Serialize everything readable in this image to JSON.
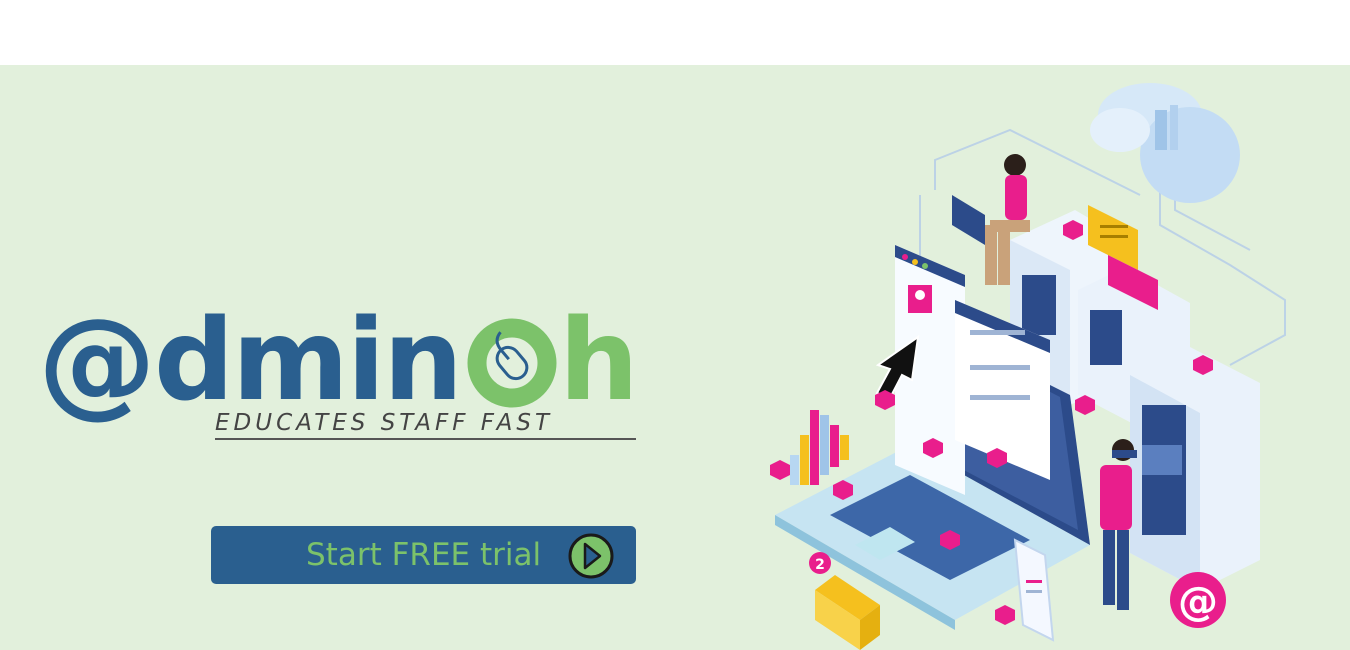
{
  "brand": {
    "logo_at": "@",
    "logo_dmin": "dmin",
    "logo_o_icon": "mouse-icon",
    "logo_h": "h",
    "tagline": "EDUCATES STAFF FAST"
  },
  "cta": {
    "label": "Start FREE trial",
    "icon": "play-circle-icon"
  },
  "illustration": {
    "email_badge_count": "2",
    "at_symbol": "@"
  },
  "colors": {
    "hero_background": "#e2f0dc",
    "brand_blue": "#2a5f8f",
    "brand_green": "#7cc26a",
    "accent_pink": "#e91e8c"
  }
}
